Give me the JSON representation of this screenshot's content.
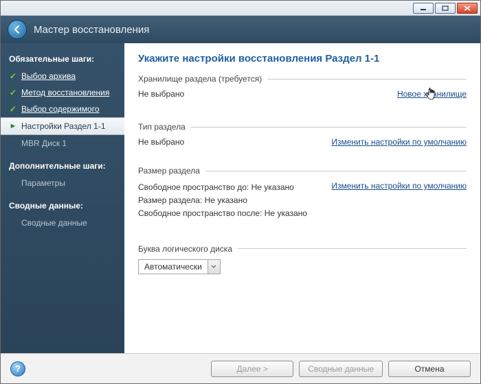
{
  "window": {
    "title": "Мастер восстановления"
  },
  "sidebar": {
    "heading_required": "Обязательные шаги:",
    "heading_optional": "Дополнительные шаги:",
    "heading_summary": "Сводные данные:",
    "items": [
      {
        "label": "Выбор архива",
        "status": "done"
      },
      {
        "label": "Метод восстановления",
        "status": "done"
      },
      {
        "label": "Выбор содержимого",
        "status": "done"
      },
      {
        "label": "Настройки Раздел 1-1",
        "status": "current"
      },
      {
        "label": "MBR Диск 1",
        "status": "pending"
      }
    ],
    "optional_item": "Параметры",
    "summary_item": "Сводные данные"
  },
  "main": {
    "page_title": "Укажите настройки восстановления Раздел 1-1",
    "storage": {
      "label": "Хранилище раздела (требуется)",
      "value": "Не выбрано",
      "link": "Новое хранилище"
    },
    "type": {
      "label": "Тип раздела",
      "value": "Не выбрано",
      "link": "Изменить настройки по умолчанию"
    },
    "size": {
      "label": "Размер раздела",
      "free_before_lbl": "Свободное пространство до:",
      "free_before_val": "Не указано",
      "size_lbl": "Размер раздела:",
      "size_val": "Не указано",
      "free_after_lbl": "Свободное пространство после:",
      "free_after_val": "Не указано",
      "link": "Изменить настройки по умолчанию"
    },
    "drive_letter": {
      "label": "Буква логического диска",
      "value": "Автоматически"
    }
  },
  "footer": {
    "next": "Далее >",
    "summary": "Сводные данные",
    "cancel": "Отмена"
  }
}
